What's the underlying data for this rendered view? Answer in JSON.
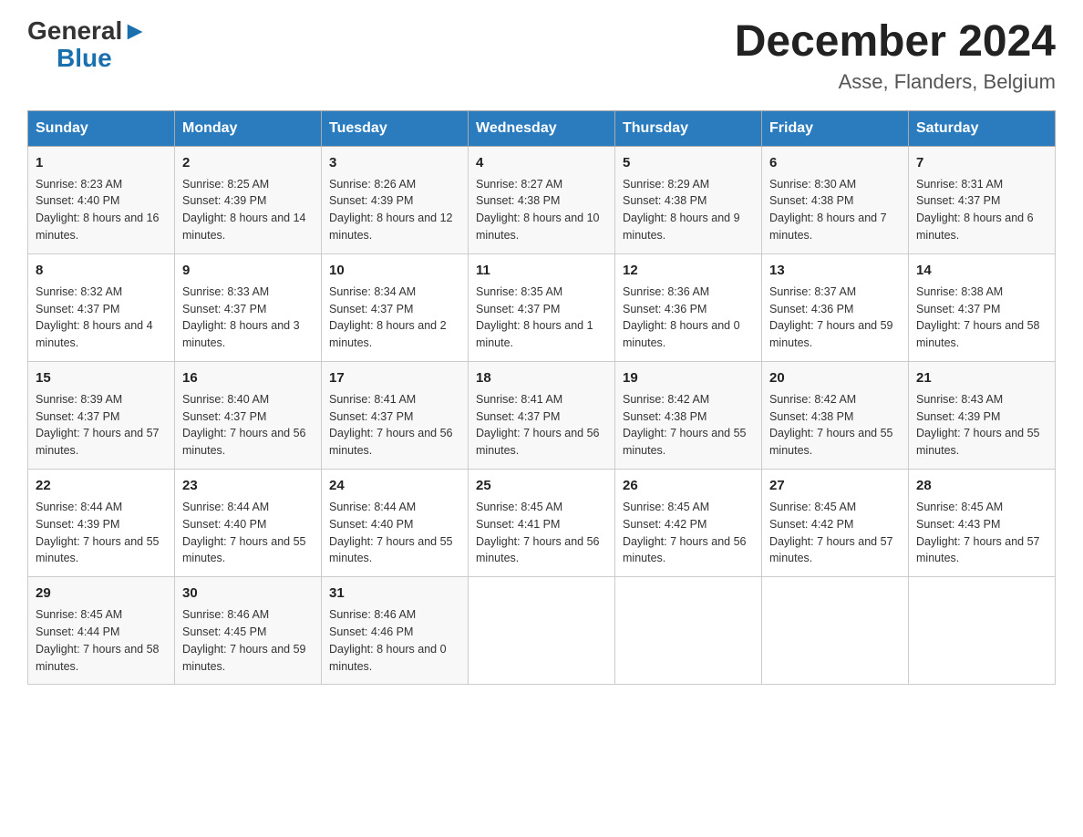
{
  "header": {
    "logo_general": "General",
    "logo_blue": "Blue",
    "title": "December 2024",
    "subtitle": "Asse, Flanders, Belgium"
  },
  "days_of_week": [
    "Sunday",
    "Monday",
    "Tuesday",
    "Wednesday",
    "Thursday",
    "Friday",
    "Saturday"
  ],
  "weeks": [
    [
      {
        "day": "1",
        "sunrise": "8:23 AM",
        "sunset": "4:40 PM",
        "daylight": "8 hours and 16 minutes."
      },
      {
        "day": "2",
        "sunrise": "8:25 AM",
        "sunset": "4:39 PM",
        "daylight": "8 hours and 14 minutes."
      },
      {
        "day": "3",
        "sunrise": "8:26 AM",
        "sunset": "4:39 PM",
        "daylight": "8 hours and 12 minutes."
      },
      {
        "day": "4",
        "sunrise": "8:27 AM",
        "sunset": "4:38 PM",
        "daylight": "8 hours and 10 minutes."
      },
      {
        "day": "5",
        "sunrise": "8:29 AM",
        "sunset": "4:38 PM",
        "daylight": "8 hours and 9 minutes."
      },
      {
        "day": "6",
        "sunrise": "8:30 AM",
        "sunset": "4:38 PM",
        "daylight": "8 hours and 7 minutes."
      },
      {
        "day": "7",
        "sunrise": "8:31 AM",
        "sunset": "4:37 PM",
        "daylight": "8 hours and 6 minutes."
      }
    ],
    [
      {
        "day": "8",
        "sunrise": "8:32 AM",
        "sunset": "4:37 PM",
        "daylight": "8 hours and 4 minutes."
      },
      {
        "day": "9",
        "sunrise": "8:33 AM",
        "sunset": "4:37 PM",
        "daylight": "8 hours and 3 minutes."
      },
      {
        "day": "10",
        "sunrise": "8:34 AM",
        "sunset": "4:37 PM",
        "daylight": "8 hours and 2 minutes."
      },
      {
        "day": "11",
        "sunrise": "8:35 AM",
        "sunset": "4:37 PM",
        "daylight": "8 hours and 1 minute."
      },
      {
        "day": "12",
        "sunrise": "8:36 AM",
        "sunset": "4:36 PM",
        "daylight": "8 hours and 0 minutes."
      },
      {
        "day": "13",
        "sunrise": "8:37 AM",
        "sunset": "4:36 PM",
        "daylight": "7 hours and 59 minutes."
      },
      {
        "day": "14",
        "sunrise": "8:38 AM",
        "sunset": "4:37 PM",
        "daylight": "7 hours and 58 minutes."
      }
    ],
    [
      {
        "day": "15",
        "sunrise": "8:39 AM",
        "sunset": "4:37 PM",
        "daylight": "7 hours and 57 minutes."
      },
      {
        "day": "16",
        "sunrise": "8:40 AM",
        "sunset": "4:37 PM",
        "daylight": "7 hours and 56 minutes."
      },
      {
        "day": "17",
        "sunrise": "8:41 AM",
        "sunset": "4:37 PM",
        "daylight": "7 hours and 56 minutes."
      },
      {
        "day": "18",
        "sunrise": "8:41 AM",
        "sunset": "4:37 PM",
        "daylight": "7 hours and 56 minutes."
      },
      {
        "day": "19",
        "sunrise": "8:42 AM",
        "sunset": "4:38 PM",
        "daylight": "7 hours and 55 minutes."
      },
      {
        "day": "20",
        "sunrise": "8:42 AM",
        "sunset": "4:38 PM",
        "daylight": "7 hours and 55 minutes."
      },
      {
        "day": "21",
        "sunrise": "8:43 AM",
        "sunset": "4:39 PM",
        "daylight": "7 hours and 55 minutes."
      }
    ],
    [
      {
        "day": "22",
        "sunrise": "8:44 AM",
        "sunset": "4:39 PM",
        "daylight": "7 hours and 55 minutes."
      },
      {
        "day": "23",
        "sunrise": "8:44 AM",
        "sunset": "4:40 PM",
        "daylight": "7 hours and 55 minutes."
      },
      {
        "day": "24",
        "sunrise": "8:44 AM",
        "sunset": "4:40 PM",
        "daylight": "7 hours and 55 minutes."
      },
      {
        "day": "25",
        "sunrise": "8:45 AM",
        "sunset": "4:41 PM",
        "daylight": "7 hours and 56 minutes."
      },
      {
        "day": "26",
        "sunrise": "8:45 AM",
        "sunset": "4:42 PM",
        "daylight": "7 hours and 56 minutes."
      },
      {
        "day": "27",
        "sunrise": "8:45 AM",
        "sunset": "4:42 PM",
        "daylight": "7 hours and 57 minutes."
      },
      {
        "day": "28",
        "sunrise": "8:45 AM",
        "sunset": "4:43 PM",
        "daylight": "7 hours and 57 minutes."
      }
    ],
    [
      {
        "day": "29",
        "sunrise": "8:45 AM",
        "sunset": "4:44 PM",
        "daylight": "7 hours and 58 minutes."
      },
      {
        "day": "30",
        "sunrise": "8:46 AM",
        "sunset": "4:45 PM",
        "daylight": "7 hours and 59 minutes."
      },
      {
        "day": "31",
        "sunrise": "8:46 AM",
        "sunset": "4:46 PM",
        "daylight": "8 hours and 0 minutes."
      },
      null,
      null,
      null,
      null
    ]
  ],
  "labels": {
    "sunrise": "Sunrise:",
    "sunset": "Sunset:",
    "daylight": "Daylight:"
  }
}
